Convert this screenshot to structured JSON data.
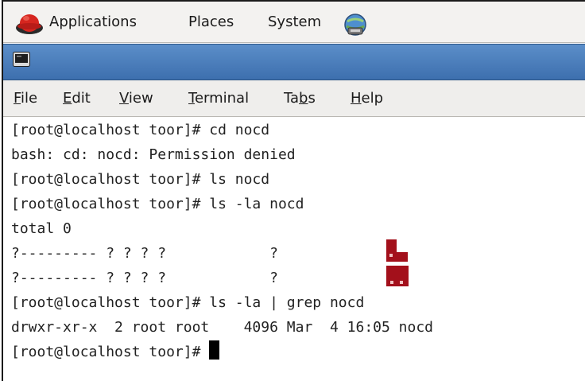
{
  "panel": {
    "applications": "Applications",
    "places": "Places",
    "system": "System"
  },
  "menubar": {
    "file": "ile",
    "file_mnemonic": "F",
    "edit": "dit",
    "edit_mnemonic": "E",
    "view": "iew",
    "view_mnemonic": "V",
    "terminal": "erminal",
    "terminal_mnemonic": "T",
    "tabs_pre": "Ta",
    "tabs_mnemonic": "b",
    "tabs_post": "s",
    "help": "elp",
    "help_mnemonic": "H"
  },
  "terminal": {
    "lines": [
      "[root@localhost toor]# cd nocd",
      "bash: cd: nocd: Permission denied",
      "[root@localhost toor]# ls nocd",
      "[root@localhost toor]# ls -la nocd",
      "total 0",
      "?--------- ? ? ? ?            ?",
      "?--------- ? ? ? ?            ?",
      "[root@localhost toor]# ls -la | grep nocd",
      "drwxr-xr-x  2 root root    4096 Mar  4 16:05 nocd",
      "[root@localhost toor]# "
    ]
  },
  "icons": {
    "panel_logo": "redhat-icon",
    "panel_network": "network-icon",
    "window_icon": "terminal-icon",
    "cursor": "text-cursor"
  },
  "colors": {
    "titlebar": "#4a7dbb",
    "corrupt_glyph": "#a3101b"
  }
}
